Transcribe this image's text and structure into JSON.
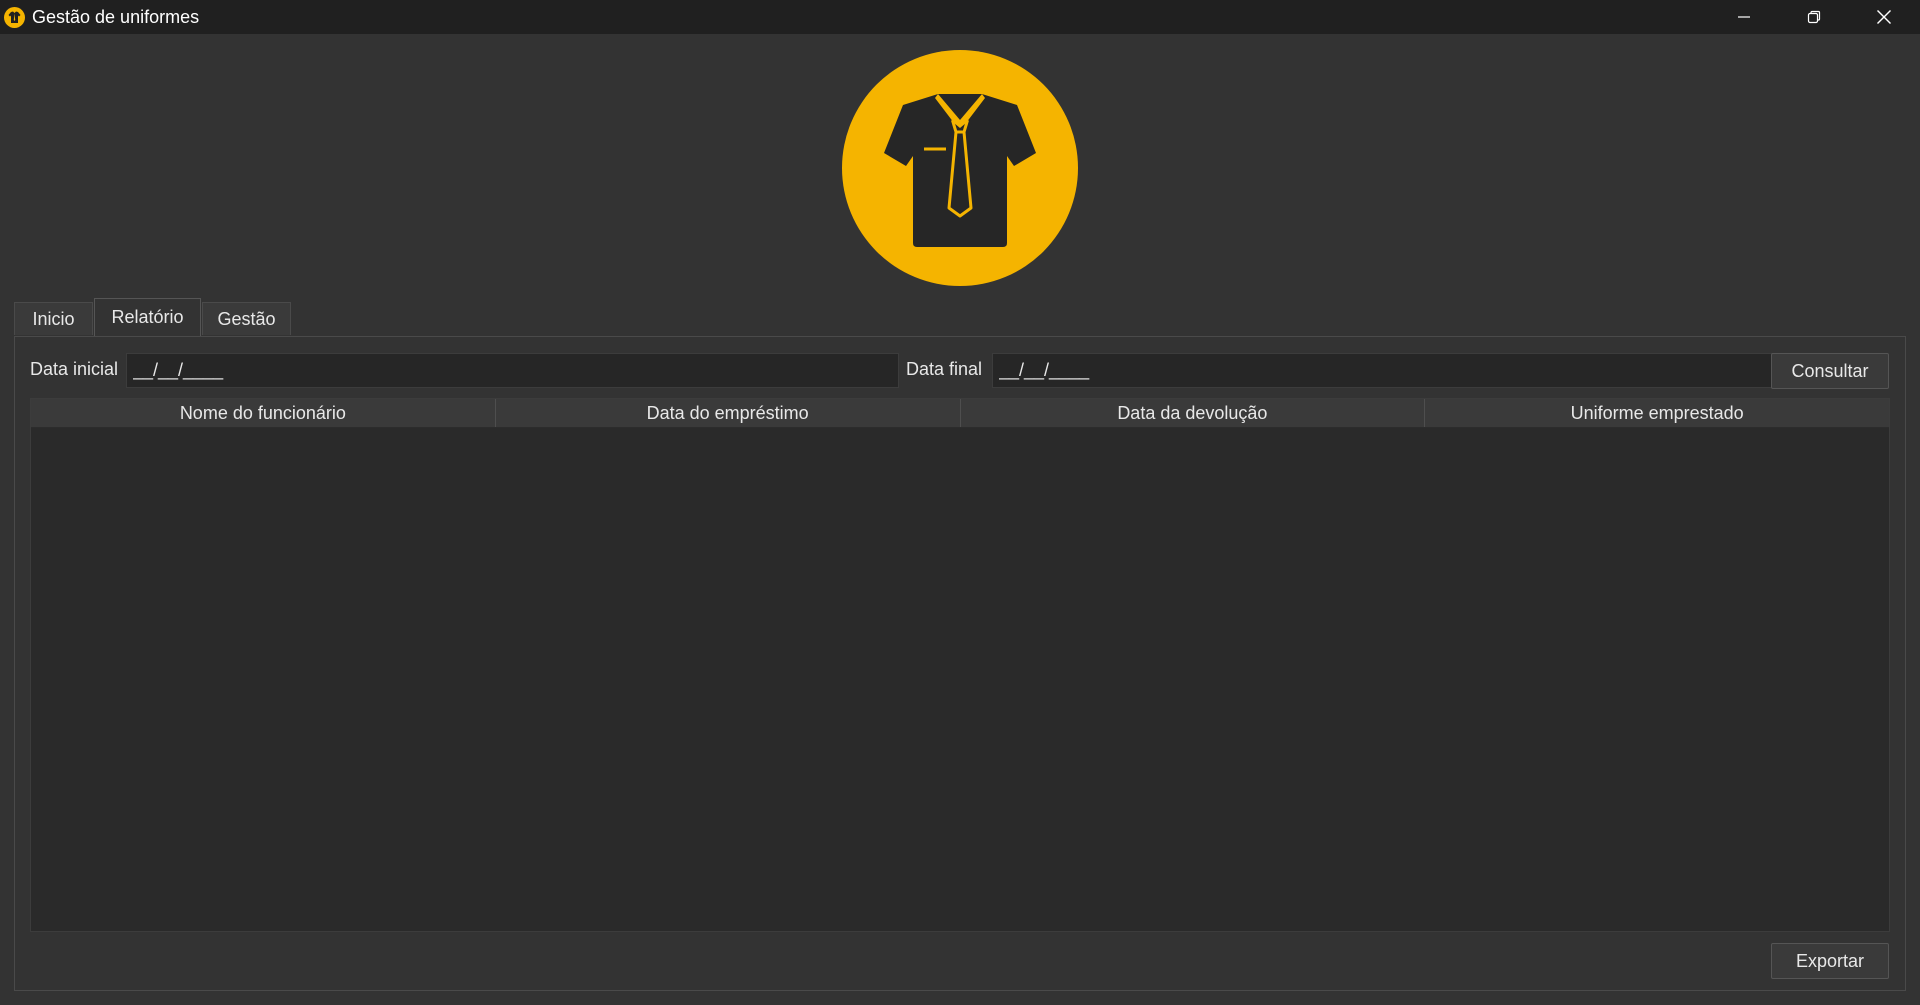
{
  "window": {
    "title": "Gestão de uniformes",
    "icon": "shirt-tie-icon",
    "accent_color": "#F5B400",
    "controls": [
      "minimize-icon",
      "restore-icon",
      "close-icon"
    ]
  },
  "logo": {
    "icon": "shirt-tie-icon",
    "color": "#F5B400"
  },
  "tabs": [
    {
      "label": "Inicio",
      "active": false
    },
    {
      "label": "Relatório",
      "active": true
    },
    {
      "label": "Gestão",
      "active": false
    }
  ],
  "filters": {
    "start_label": "Data inicial",
    "start_value": "__/__/____",
    "end_label": "Data final",
    "end_value": "__/__/____",
    "query_button": "Consultar"
  },
  "table": {
    "columns": [
      "Nome do funcionário",
      "Data do empréstimo",
      "Data da devolução",
      "Uniforme emprestado"
    ],
    "rows": []
  },
  "export_button": "Exportar"
}
